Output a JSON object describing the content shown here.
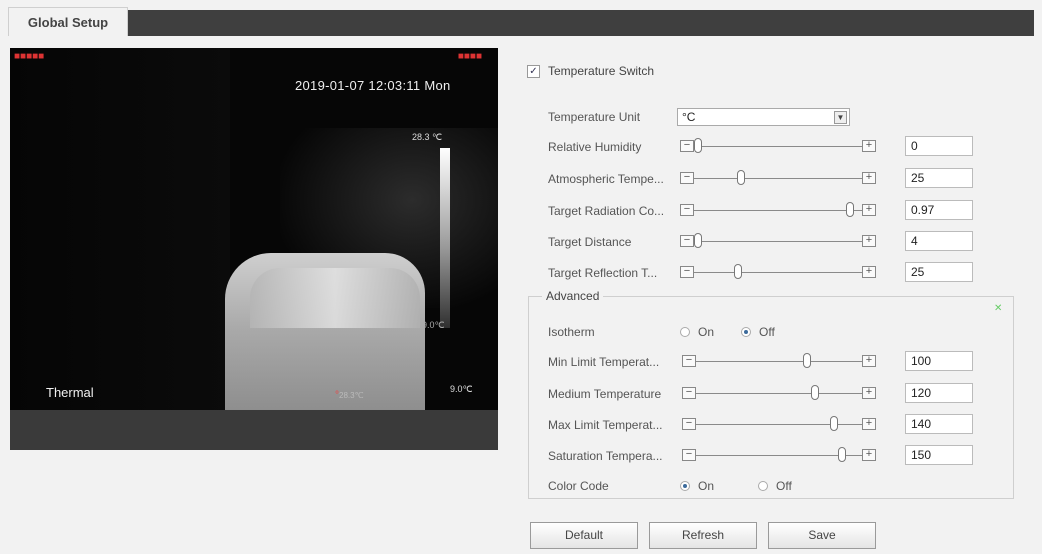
{
  "tab": {
    "label": "Global Setup"
  },
  "video": {
    "timestamp": "2019-01-07 12:03:11 Mon",
    "scale_max": "28.3 ℃",
    "scale_min": "9.0℃",
    "bottom_right": "9.0℃",
    "channel_label": "Thermal",
    "point_label": "28.3℃"
  },
  "temperature_switch": {
    "label": "Temperature Switch",
    "checked": true
  },
  "temperature_unit": {
    "label": "Temperature Unit",
    "value": "°C"
  },
  "sliders": [
    {
      "label": "Relative Humidity",
      "value": "0",
      "fraction": 0.0
    },
    {
      "label": "Atmospheric Tempe...",
      "value": "25",
      "fraction": 0.27
    },
    {
      "label": "Target Radiation Co...",
      "value": "0.97",
      "fraction": 0.95
    },
    {
      "label": "Target Distance",
      "value": "4",
      "fraction": 0.0
    },
    {
      "label": "Target Reflection T...",
      "value": "25",
      "fraction": 0.25
    }
  ],
  "advanced": {
    "title": "Advanced",
    "isotherm": {
      "label": "Isotherm",
      "options": [
        "On",
        "Off"
      ],
      "selected": "Off"
    },
    "sliders": [
      {
        "label": "Min Limit Temperat...",
        "value": "100",
        "fraction": 0.68
      },
      {
        "label": "Medium Temperature",
        "value": "120",
        "fraction": 0.73
      },
      {
        "label": "Max Limit Temperat...",
        "value": "140",
        "fraction": 0.85
      },
      {
        "label": "Saturation Tempera...",
        "value": "150",
        "fraction": 0.9
      }
    ],
    "color_code": {
      "label": "Color Code",
      "options": [
        "On",
        "Off"
      ],
      "selected": "On"
    }
  },
  "buttons": {
    "default": "Default",
    "refresh": "Refresh",
    "save": "Save"
  }
}
